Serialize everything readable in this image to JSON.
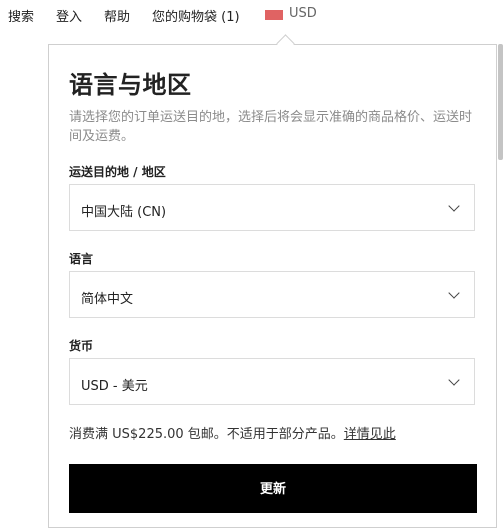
{
  "nav": {
    "search": "搜索",
    "login": "登入",
    "help": "帮助",
    "bag": "您的购物袋 (1)",
    "currency": "USD"
  },
  "panel": {
    "title": "语言与地区",
    "description": "请选择您的订单运送目的地，选择后将会显示准确的商品格价、运送时间及运费。",
    "destination": {
      "label": "运送目的地 / 地区",
      "value": "中国大陆 (CN)"
    },
    "language": {
      "label": "语言",
      "value": "简体中文"
    },
    "currency": {
      "label": "货币",
      "value": "USD - 美元"
    },
    "shipping_note": "消费满 US$225.00 包邮。不适用于部分产品。",
    "details_link": "详情见此",
    "update_button": "更新"
  },
  "colors": {
    "flag": "#e06363",
    "button_bg": "#000000"
  }
}
